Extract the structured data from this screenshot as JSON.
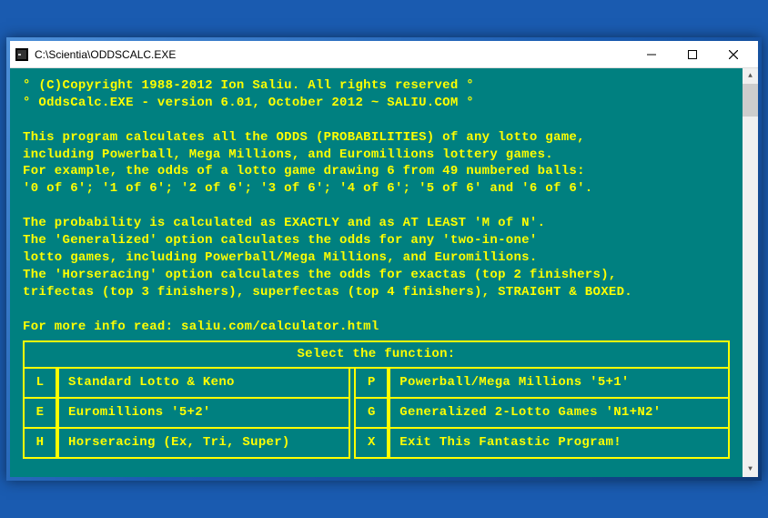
{
  "titlebar": {
    "path": "C:\\Scientia\\ODDSCALC.EXE"
  },
  "console": {
    "lines": [
      "° (C)Copyright 1988-2012 Ion Saliu. All rights reserved °",
      "° OddsCalc.EXE - version 6.01, October 2012 ~ SALIU.COM °",
      "",
      "This program calculates all the ODDS (PROBABILITIES) of any lotto game,",
      "including Powerball, Mega Millions, and Euromillions lottery games.",
      "For example, the odds of a lotto game drawing 6 from 49 numbered balls:",
      "'0 of 6'; '1 of 6'; '2 of 6'; '3 of 6'; '4 of 6'; '5 of 6' and '6 of 6'.",
      "",
      "The probability is calculated as EXACTLY and as AT LEAST 'M of N'.",
      "The 'Generalized' option calculates the odds for any 'two-in-one'",
      "lotto games, including Powerball/Mega Millions, and Euromillions.",
      "The 'Horseracing' option calculates the odds for exactas (top 2 finishers),",
      "trifectas (top 3 finishers), superfectas (top 4 finishers), STRAIGHT & BOXED.",
      "",
      "For more info read: saliu.com/calculator.html"
    ],
    "menu": {
      "title": "Select the function:",
      "rows": [
        {
          "leftKey": "L",
          "leftLabel": "Standard Lotto & Keno",
          "rightKey": "P",
          "rightLabel": "Powerball/Mega Millions '5+1'"
        },
        {
          "leftKey": "E",
          "leftLabel": "Euromillions '5+2'",
          "rightKey": "G",
          "rightLabel": "Generalized 2-Lotto Games 'N1+N2'"
        },
        {
          "leftKey": "H",
          "leftLabel": "Horseracing (Ex, Tri, Super)",
          "rightKey": "X",
          "rightLabel": "Exit This Fantastic Program!"
        }
      ]
    }
  }
}
